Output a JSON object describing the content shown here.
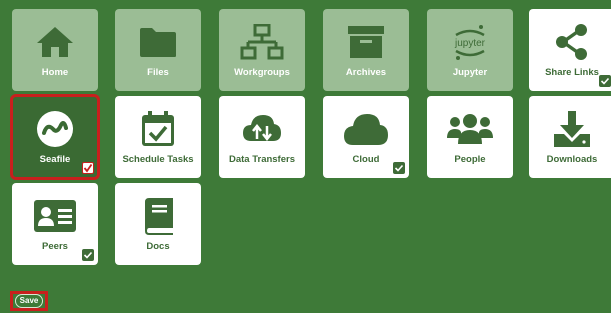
{
  "tiles": [
    {
      "label": "Home",
      "icon": "home-icon",
      "state": "inactive",
      "checked": false
    },
    {
      "label": "Files",
      "icon": "folder-icon",
      "state": "inactive",
      "checked": false
    },
    {
      "label": "Workgroups",
      "icon": "network-icon",
      "state": "inactive",
      "checked": false
    },
    {
      "label": "Archives",
      "icon": "archive-box-icon",
      "state": "inactive",
      "checked": false
    },
    {
      "label": "Jupyter",
      "icon": "jupyter-icon",
      "state": "inactive",
      "checked": false,
      "icon_text": "jupyter"
    },
    {
      "label": "Share Links",
      "icon": "share-icon",
      "state": "active",
      "checked": true
    },
    {
      "label": "Seafile",
      "icon": "seafile-icon",
      "state": "selected",
      "checked": true
    },
    {
      "label": "Schedule Tasks",
      "icon": "calendar-check-icon",
      "state": "active",
      "checked": false
    },
    {
      "label": "Data Transfers",
      "icon": "cloud-transfer-icon",
      "state": "active",
      "checked": false
    },
    {
      "label": "Cloud",
      "icon": "cloud-icon",
      "state": "active",
      "checked": true
    },
    {
      "label": "People",
      "icon": "people-icon",
      "state": "active",
      "checked": false
    },
    {
      "label": "Downloads",
      "icon": "download-icon",
      "state": "active",
      "checked": false
    },
    {
      "label": "Peers",
      "icon": "id-card-icon",
      "state": "active",
      "checked": true
    },
    {
      "label": "Docs",
      "icon": "book-icon",
      "state": "active",
      "checked": false
    }
  ],
  "save_label": "Save",
  "colors": {
    "background": "#3e7a38",
    "inactive_tile": "#9bbd95",
    "active_tile": "#ffffff",
    "accent": "#3e6b37",
    "highlight": "#c8201d"
  }
}
